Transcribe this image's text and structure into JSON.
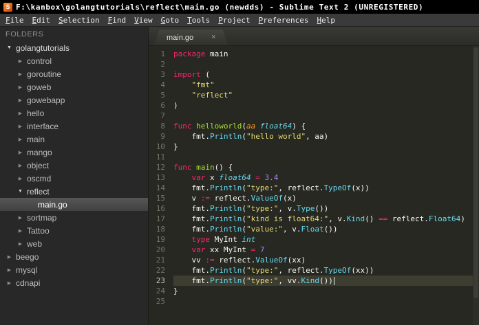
{
  "window": {
    "title": "F:\\kanbox\\golangtutorials\\reflect\\main.go (newdds) - Sublime Text 2 (UNREGISTERED)",
    "app_icon_letter": "S"
  },
  "menu": {
    "items": [
      "File",
      "Edit",
      "Selection",
      "Find",
      "View",
      "Goto",
      "Tools",
      "Project",
      "Preferences",
      "Help"
    ]
  },
  "sidebar": {
    "header": "FOLDERS",
    "items": [
      {
        "label": "golangtutorials",
        "depth": 0,
        "state": "expanded",
        "selected": false
      },
      {
        "label": "control",
        "depth": 1,
        "state": "collapsed",
        "selected": false
      },
      {
        "label": "goroutine",
        "depth": 1,
        "state": "collapsed",
        "selected": false
      },
      {
        "label": "goweb",
        "depth": 1,
        "state": "collapsed",
        "selected": false
      },
      {
        "label": "gowebapp",
        "depth": 1,
        "state": "collapsed",
        "selected": false
      },
      {
        "label": "hello",
        "depth": 1,
        "state": "collapsed",
        "selected": false
      },
      {
        "label": "interface",
        "depth": 1,
        "state": "collapsed",
        "selected": false
      },
      {
        "label": "main",
        "depth": 1,
        "state": "collapsed",
        "selected": false
      },
      {
        "label": "mango",
        "depth": 1,
        "state": "collapsed",
        "selected": false
      },
      {
        "label": "object",
        "depth": 1,
        "state": "collapsed",
        "selected": false
      },
      {
        "label": "oscmd",
        "depth": 1,
        "state": "collapsed",
        "selected": false
      },
      {
        "label": "reflect",
        "depth": 1,
        "state": "expanded",
        "selected": false
      },
      {
        "label": "main.go",
        "depth": 2,
        "state": "file",
        "selected": true
      },
      {
        "label": "sortmap",
        "depth": 1,
        "state": "collapsed",
        "selected": false
      },
      {
        "label": "Tattoo",
        "depth": 1,
        "state": "collapsed",
        "selected": false
      },
      {
        "label": "web",
        "depth": 1,
        "state": "collapsed",
        "selected": false
      },
      {
        "label": "beego",
        "depth": 0,
        "state": "collapsed",
        "selected": false
      },
      {
        "label": "mysql",
        "depth": 0,
        "state": "collapsed",
        "selected": false
      },
      {
        "label": "cdnapi",
        "depth": 0,
        "state": "collapsed",
        "selected": false
      }
    ]
  },
  "editor": {
    "tab": {
      "label": "main.go",
      "close_icon": "×"
    },
    "code": {
      "lines": [
        {
          "n": "1",
          "segs": [
            [
              "k",
              "package"
            ],
            [
              "p",
              " main"
            ]
          ]
        },
        {
          "n": "2",
          "segs": []
        },
        {
          "n": "3",
          "segs": [
            [
              "k",
              "import"
            ],
            [
              "p",
              " ("
            ]
          ]
        },
        {
          "n": "4",
          "segs": [
            [
              "p",
              "    "
            ],
            [
              "s",
              "\"fmt\""
            ]
          ]
        },
        {
          "n": "5",
          "segs": [
            [
              "p",
              "    "
            ],
            [
              "s",
              "\"reflect\""
            ]
          ]
        },
        {
          "n": "6",
          "segs": [
            [
              "p",
              ")"
            ]
          ]
        },
        {
          "n": "7",
          "segs": []
        },
        {
          "n": "8",
          "segs": [
            [
              "k",
              "func"
            ],
            [
              "g",
              " helloworld"
            ],
            [
              "p",
              "("
            ],
            [
              "a",
              "aa"
            ],
            [
              "p",
              " "
            ],
            [
              "t",
              "float64"
            ],
            [
              "p",
              ") {"
            ]
          ]
        },
        {
          "n": "9",
          "segs": [
            [
              "p",
              "    fmt."
            ],
            [
              "f",
              "Println"
            ],
            [
              "p",
              "("
            ],
            [
              "s",
              "\"hello world\""
            ],
            [
              "p",
              ", aa)"
            ]
          ]
        },
        {
          "n": "10",
          "segs": [
            [
              "p",
              "}"
            ]
          ]
        },
        {
          "n": "11",
          "segs": []
        },
        {
          "n": "12",
          "segs": [
            [
              "k",
              "func"
            ],
            [
              "g",
              " main"
            ],
            [
              "p",
              "() {"
            ]
          ]
        },
        {
          "n": "13",
          "segs": [
            [
              "p",
              "    "
            ],
            [
              "k",
              "var"
            ],
            [
              "p",
              " x "
            ],
            [
              "t",
              "float64"
            ],
            [
              "o",
              " ="
            ],
            [
              "p",
              " "
            ],
            [
              "n",
              "3.4"
            ]
          ]
        },
        {
          "n": "14",
          "segs": [
            [
              "p",
              "    fmt."
            ],
            [
              "f",
              "Println"
            ],
            [
              "p",
              "("
            ],
            [
              "s",
              "\"type:\""
            ],
            [
              "p",
              ", reflect."
            ],
            [
              "f",
              "TypeOf"
            ],
            [
              "p",
              "(x))"
            ]
          ]
        },
        {
          "n": "15",
          "segs": [
            [
              "p",
              "    v "
            ],
            [
              "o",
              ":="
            ],
            [
              "p",
              " reflect."
            ],
            [
              "f",
              "ValueOf"
            ],
            [
              "p",
              "(x)"
            ]
          ]
        },
        {
          "n": "16",
          "segs": [
            [
              "p",
              "    fmt."
            ],
            [
              "f",
              "Println"
            ],
            [
              "p",
              "("
            ],
            [
              "s",
              "\"type:\""
            ],
            [
              "p",
              ", v."
            ],
            [
              "f",
              "Type"
            ],
            [
              "p",
              "())"
            ]
          ]
        },
        {
          "n": "17",
          "segs": [
            [
              "p",
              "    fmt."
            ],
            [
              "f",
              "Println"
            ],
            [
              "p",
              "("
            ],
            [
              "s",
              "\"kind is float64:\""
            ],
            [
              "p",
              ", v."
            ],
            [
              "f",
              "Kind"
            ],
            [
              "p",
              "() "
            ],
            [
              "o",
              "=="
            ],
            [
              "p",
              " reflect."
            ],
            [
              "f",
              "Float64"
            ],
            [
              "p",
              ")"
            ]
          ]
        },
        {
          "n": "18",
          "segs": [
            [
              "p",
              "    fmt."
            ],
            [
              "f",
              "Println"
            ],
            [
              "p",
              "("
            ],
            [
              "s",
              "\"value:\""
            ],
            [
              "p",
              ", v."
            ],
            [
              "f",
              "Float"
            ],
            [
              "p",
              "())"
            ]
          ]
        },
        {
          "n": "19",
          "segs": [
            [
              "p",
              "    "
            ],
            [
              "k",
              "type"
            ],
            [
              "p",
              " MyInt "
            ],
            [
              "t",
              "int"
            ]
          ]
        },
        {
          "n": "20",
          "segs": [
            [
              "p",
              "    "
            ],
            [
              "k",
              "var"
            ],
            [
              "p",
              " xx MyInt "
            ],
            [
              "o",
              "="
            ],
            [
              "p",
              " "
            ],
            [
              "n",
              "7"
            ]
          ]
        },
        {
          "n": "21",
          "segs": [
            [
              "p",
              "    vv "
            ],
            [
              "o",
              ":="
            ],
            [
              "p",
              " reflect."
            ],
            [
              "f",
              "ValueOf"
            ],
            [
              "p",
              "(xx)"
            ]
          ]
        },
        {
          "n": "22",
          "segs": [
            [
              "p",
              "    fmt."
            ],
            [
              "f",
              "Println"
            ],
            [
              "p",
              "("
            ],
            [
              "s",
              "\"type:\""
            ],
            [
              "p",
              ", reflect."
            ],
            [
              "f",
              "TypeOf"
            ],
            [
              "p",
              "(xx))"
            ]
          ]
        },
        {
          "n": "23",
          "current": true,
          "caret": true,
          "segs": [
            [
              "p",
              "    fmt."
            ],
            [
              "f",
              "Println"
            ],
            [
              "p",
              "("
            ],
            [
              "s",
              "\"type:\""
            ],
            [
              "p",
              ", vv."
            ],
            [
              "f",
              "Kind"
            ],
            [
              "p",
              "())"
            ]
          ]
        },
        {
          "n": "24",
          "segs": [
            [
              "p",
              "}"
            ]
          ]
        },
        {
          "n": "25",
          "segs": []
        }
      ]
    }
  },
  "theme": {
    "editor_bg": "#272822",
    "keyword": "#f92672",
    "string": "#e6db74",
    "number": "#ae81ff",
    "function_call": "#66d9ef",
    "type": "#66d9ef",
    "function_def": "#a6e22e",
    "parameter": "#fd971f",
    "current_line": "#3e3d32"
  }
}
